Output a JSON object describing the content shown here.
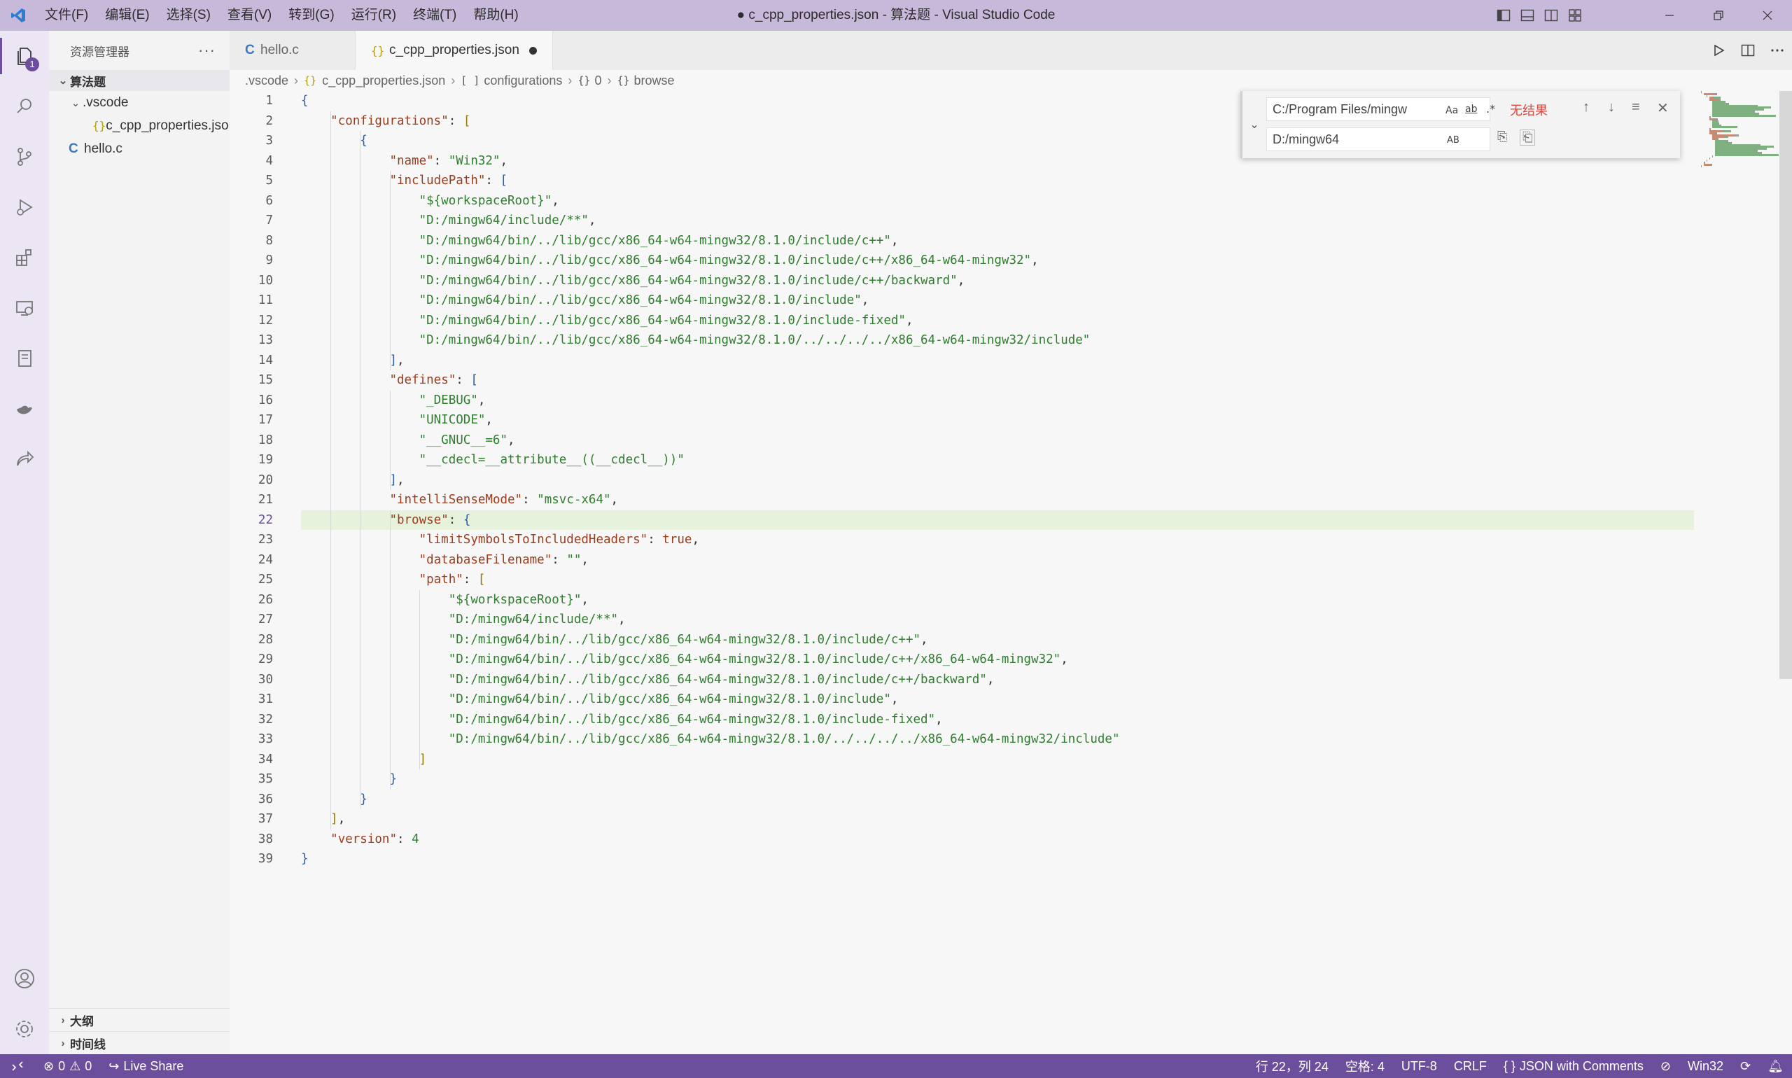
{
  "window": {
    "title": "● c_cpp_properties.json - 算法题 - Visual Studio Code",
    "menu": [
      "文件(F)",
      "编辑(E)",
      "选择(S)",
      "查看(V)",
      "转到(G)",
      "运行(R)",
      "终端(T)",
      "帮助(H)"
    ]
  },
  "activity": {
    "explorer_badge": "1",
    "icons": [
      "files-icon",
      "search-icon",
      "source-control-icon",
      "run-debug-icon",
      "extensions-icon",
      "remote-explorer-icon",
      "notebook-icon",
      "docker-icon",
      "live-share-icon"
    ],
    "bottom_icons": [
      "account-icon",
      "settings-gear-icon"
    ]
  },
  "sidebar": {
    "title": "资源管理器",
    "more": "···",
    "root": "算法题",
    "items": [
      {
        "label": ".vscode",
        "type": "folder"
      },
      {
        "label": "c_cpp_properties.json",
        "type": "json",
        "icon_text": "{}"
      },
      {
        "label": "hello.c",
        "type": "c",
        "icon_text": "C"
      }
    ],
    "sections": [
      "大纲",
      "时间线"
    ]
  },
  "tabs": [
    {
      "label": "hello.c",
      "icon": "C",
      "active": false
    },
    {
      "label": "c_cpp_properties.json",
      "icon": "{}",
      "active": true,
      "dirty": true
    }
  ],
  "breadcrumb": [
    {
      "label": ".vscode",
      "icon": ""
    },
    {
      "label": "c_cpp_properties.json",
      "icon": "{}"
    },
    {
      "label": "configurations",
      "icon": "[ ]"
    },
    {
      "label": "0",
      "icon": "{}"
    },
    {
      "label": "browse",
      "icon": "{}"
    }
  ],
  "find": {
    "find_value": "C:/Program Files/mingw",
    "replace_value": "D:/mingw64",
    "result": "无结果",
    "opt_case": "Aa",
    "opt_word": "ab",
    "opt_regex": ".*",
    "opt_preserve": "AB"
  },
  "editor": {
    "current_line": 22,
    "lines": [
      [
        [
          "{",
          "b1"
        ]
      ],
      [
        [
          "    ",
          "p"
        ],
        [
          "\"configurations\"",
          "key"
        ],
        [
          ": ",
          "p"
        ],
        [
          "[",
          "b2"
        ]
      ],
      [
        [
          "        ",
          "p"
        ],
        [
          "{",
          "b1"
        ]
      ],
      [
        [
          "            ",
          "p"
        ],
        [
          "\"name\"",
          "key"
        ],
        [
          ": ",
          "p"
        ],
        [
          "\"Win32\"",
          "str"
        ],
        [
          ",",
          "p"
        ]
      ],
      [
        [
          "            ",
          "p"
        ],
        [
          "\"includePath\"",
          "key"
        ],
        [
          ": ",
          "p"
        ],
        [
          "[",
          "b1"
        ]
      ],
      [
        [
          "                ",
          "p"
        ],
        [
          "\"${workspaceRoot}\"",
          "str"
        ],
        [
          ",",
          "p"
        ]
      ],
      [
        [
          "                ",
          "p"
        ],
        [
          "\"D:/mingw64/include/**\"",
          "str"
        ],
        [
          ",",
          "p"
        ]
      ],
      [
        [
          "                ",
          "p"
        ],
        [
          "\"D:/mingw64/bin/../lib/gcc/x86_64-w64-mingw32/8.1.0/include/c++\"",
          "str"
        ],
        [
          ",",
          "p"
        ]
      ],
      [
        [
          "                ",
          "p"
        ],
        [
          "\"D:/mingw64/bin/../lib/gcc/x86_64-w64-mingw32/8.1.0/include/c++/x86_64-w64-mingw32\"",
          "str"
        ],
        [
          ",",
          "p"
        ]
      ],
      [
        [
          "                ",
          "p"
        ],
        [
          "\"D:/mingw64/bin/../lib/gcc/x86_64-w64-mingw32/8.1.0/include/c++/backward\"",
          "str"
        ],
        [
          ",",
          "p"
        ]
      ],
      [
        [
          "                ",
          "p"
        ],
        [
          "\"D:/mingw64/bin/../lib/gcc/x86_64-w64-mingw32/8.1.0/include\"",
          "str"
        ],
        [
          ",",
          "p"
        ]
      ],
      [
        [
          "                ",
          "p"
        ],
        [
          "\"D:/mingw64/bin/../lib/gcc/x86_64-w64-mingw32/8.1.0/include-fixed\"",
          "str"
        ],
        [
          ",",
          "p"
        ]
      ],
      [
        [
          "                ",
          "p"
        ],
        [
          "\"D:/mingw64/bin/../lib/gcc/x86_64-w64-mingw32/8.1.0/../../../../x86_64-w64-mingw32/include\"",
          "str"
        ]
      ],
      [
        [
          "            ",
          "p"
        ],
        [
          "]",
          "b1"
        ],
        [
          ",",
          "p"
        ]
      ],
      [
        [
          "            ",
          "p"
        ],
        [
          "\"defines\"",
          "key"
        ],
        [
          ": ",
          "p"
        ],
        [
          "[",
          "b1"
        ]
      ],
      [
        [
          "                ",
          "p"
        ],
        [
          "\"_DEBUG\"",
          "str"
        ],
        [
          ",",
          "p"
        ]
      ],
      [
        [
          "                ",
          "p"
        ],
        [
          "\"UNICODE\"",
          "str"
        ],
        [
          ",",
          "p"
        ]
      ],
      [
        [
          "                ",
          "p"
        ],
        [
          "\"__GNUC__=6\"",
          "str"
        ],
        [
          ",",
          "p"
        ]
      ],
      [
        [
          "                ",
          "p"
        ],
        [
          "\"__cdecl=__attribute__((__cdecl__))\"",
          "str"
        ]
      ],
      [
        [
          "            ",
          "p"
        ],
        [
          "]",
          "b1"
        ],
        [
          ",",
          "p"
        ]
      ],
      [
        [
          "            ",
          "p"
        ],
        [
          "\"intelliSenseMode\"",
          "key"
        ],
        [
          ": ",
          "p"
        ],
        [
          "\"msvc-x64\"",
          "str"
        ],
        [
          ",",
          "p"
        ]
      ],
      [
        [
          "            ",
          "p"
        ],
        [
          "\"browse\"",
          "key"
        ],
        [
          ": ",
          "p"
        ],
        [
          "{",
          "b1"
        ]
      ],
      [
        [
          "                ",
          "p"
        ],
        [
          "\"limitSymbolsToIncludedHeaders\"",
          "key"
        ],
        [
          ": ",
          "p"
        ],
        [
          "true",
          "kw"
        ],
        [
          ",",
          "p"
        ]
      ],
      [
        [
          "                ",
          "p"
        ],
        [
          "\"databaseFilename\"",
          "key"
        ],
        [
          ": ",
          "p"
        ],
        [
          "\"\"",
          "str"
        ],
        [
          ",",
          "p"
        ]
      ],
      [
        [
          "                ",
          "p"
        ],
        [
          "\"path\"",
          "key"
        ],
        [
          ": ",
          "p"
        ],
        [
          "[",
          "b2"
        ]
      ],
      [
        [
          "                    ",
          "p"
        ],
        [
          "\"${workspaceRoot}\"",
          "str"
        ],
        [
          ",",
          "p"
        ]
      ],
      [
        [
          "                    ",
          "p"
        ],
        [
          "\"D:/mingw64/include/**\"",
          "str"
        ],
        [
          ",",
          "p"
        ]
      ],
      [
        [
          "                    ",
          "p"
        ],
        [
          "\"D:/mingw64/bin/../lib/gcc/x86_64-w64-mingw32/8.1.0/include/c++\"",
          "str"
        ],
        [
          ",",
          "p"
        ]
      ],
      [
        [
          "                    ",
          "p"
        ],
        [
          "\"D:/mingw64/bin/../lib/gcc/x86_64-w64-mingw32/8.1.0/include/c++/x86_64-w64-mingw32\"",
          "str"
        ],
        [
          ",",
          "p"
        ]
      ],
      [
        [
          "                    ",
          "p"
        ],
        [
          "\"D:/mingw64/bin/../lib/gcc/x86_64-w64-mingw32/8.1.0/include/c++/backward\"",
          "str"
        ],
        [
          ",",
          "p"
        ]
      ],
      [
        [
          "                    ",
          "p"
        ],
        [
          "\"D:/mingw64/bin/../lib/gcc/x86_64-w64-mingw32/8.1.0/include\"",
          "str"
        ],
        [
          ",",
          "p"
        ]
      ],
      [
        [
          "                    ",
          "p"
        ],
        [
          "\"D:/mingw64/bin/../lib/gcc/x86_64-w64-mingw32/8.1.0/include-fixed\"",
          "str"
        ],
        [
          ",",
          "p"
        ]
      ],
      [
        [
          "                    ",
          "p"
        ],
        [
          "\"D:/mingw64/bin/../lib/gcc/x86_64-w64-mingw32/8.1.0/../../../../x86_64-w64-mingw32/include\"",
          "str"
        ]
      ],
      [
        [
          "                ",
          "p"
        ],
        [
          "]",
          "b2"
        ]
      ],
      [
        [
          "            ",
          "p"
        ],
        [
          "}",
          "b1"
        ]
      ],
      [
        [
          "        ",
          "p"
        ],
        [
          "}",
          "b1"
        ]
      ],
      [
        [
          "    ",
          "p"
        ],
        [
          "]",
          "b2"
        ],
        [
          ",",
          "p"
        ]
      ],
      [
        [
          "    ",
          "p"
        ],
        [
          "\"version\"",
          "key"
        ],
        [
          ": ",
          "p"
        ],
        [
          "4",
          "num"
        ]
      ],
      [
        [
          "}",
          "b1"
        ]
      ]
    ]
  },
  "status": {
    "errors": "0",
    "warnings": "0",
    "live_share": "Live Share",
    "position": "行 22，列 24",
    "spaces": "空格: 4",
    "encoding": "UTF-8",
    "eol": "CRLF",
    "language": "JSON with Comments",
    "platform": "Win32"
  },
  "colors": {
    "titlebar": "#c7b9da",
    "statusbar": "#6c4f9c",
    "accent": "#6c4f9c",
    "current_line": "#e6f2dc"
  }
}
